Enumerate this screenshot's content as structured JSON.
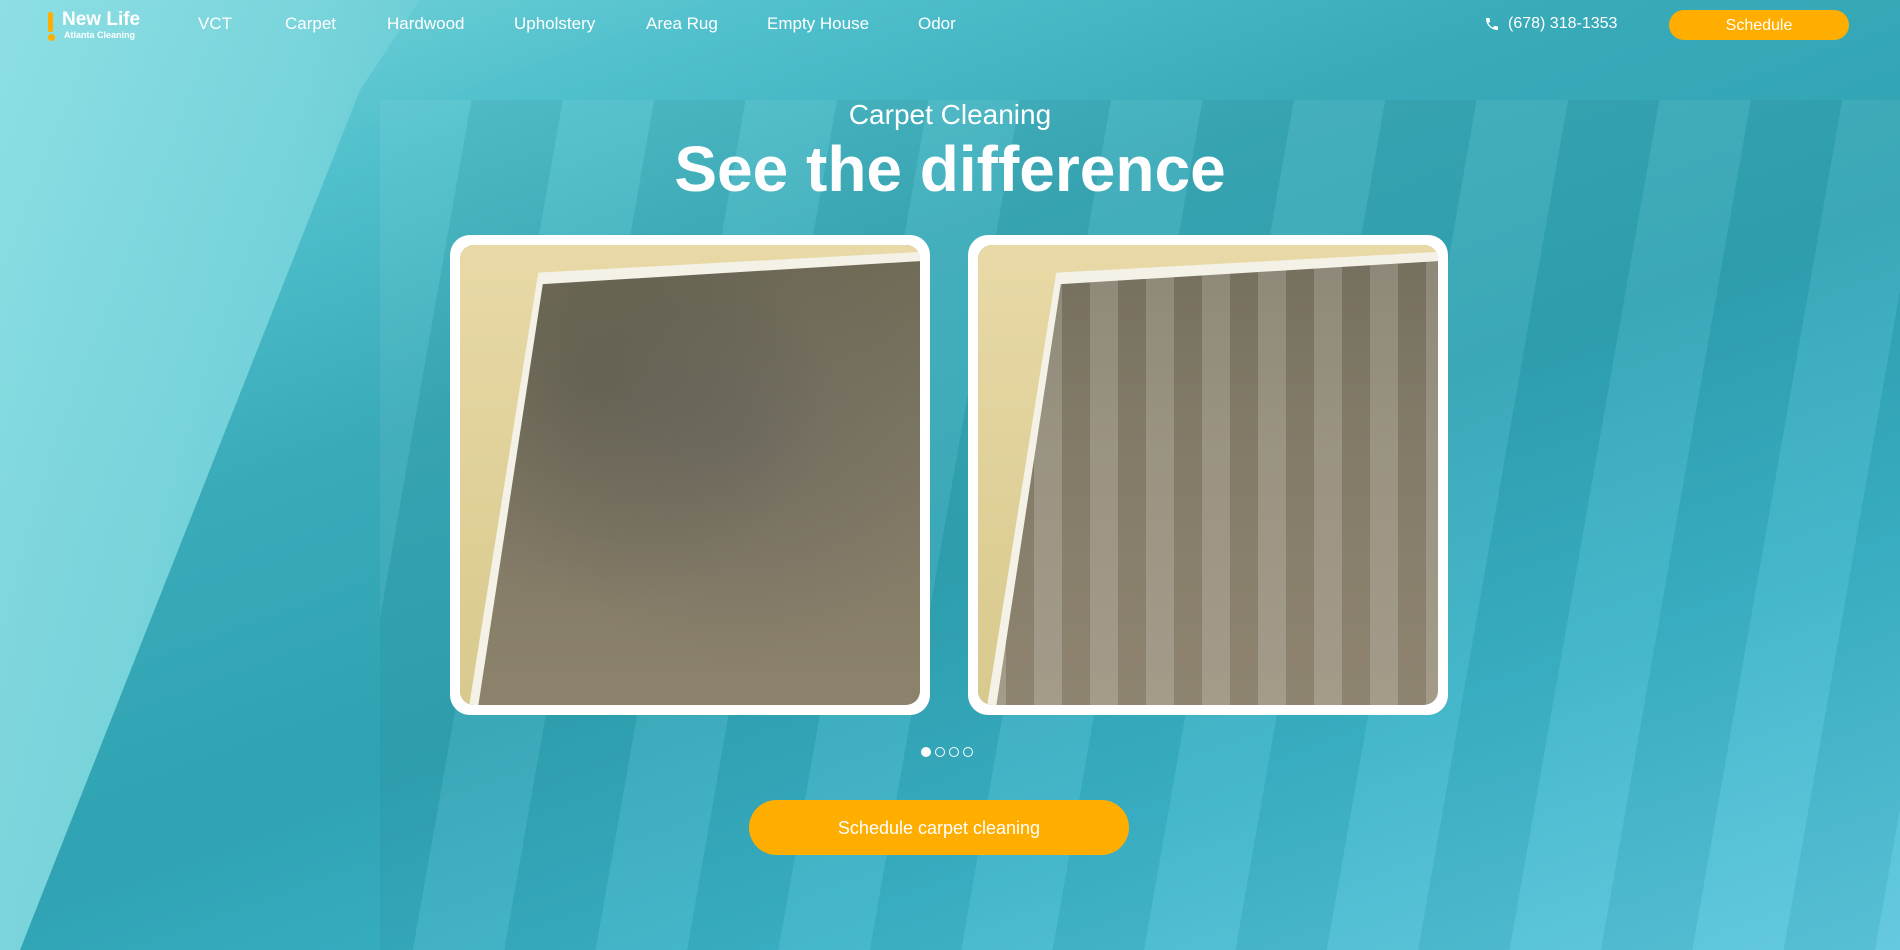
{
  "logo": {
    "name": "New Life",
    "subtitle": "Atlanta Cleaning"
  },
  "nav": [
    {
      "label": "VCT"
    },
    {
      "label": "Carpet"
    },
    {
      "label": "Hardwood"
    },
    {
      "label": "Upholstery"
    },
    {
      "label": "Area Rug"
    },
    {
      "label": "Empty House"
    },
    {
      "label": "Odor"
    }
  ],
  "header": {
    "phone": "(678) 318-1353",
    "schedule_label": "Schedule"
  },
  "hero": {
    "subtitle": "Carpet Cleaning",
    "title": "See the difference",
    "cta_label": "Schedule carpet cleaning"
  },
  "carousel": {
    "slide_count": 4,
    "active_index": 0
  },
  "colors": {
    "accent": "#ffae00",
    "text": "#ffffff",
    "background": "#3ab0c0"
  },
  "icons": {
    "phone": "phone-icon"
  }
}
